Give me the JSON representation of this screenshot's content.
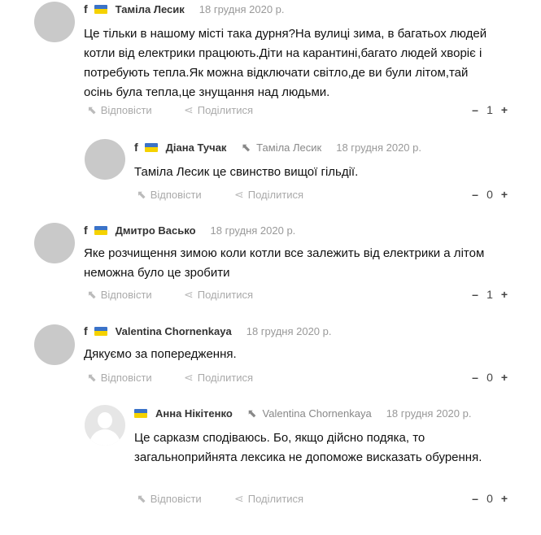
{
  "labels": {
    "reply": "Відповісти",
    "share": "Поділитися"
  },
  "icons": {
    "reply": "reply-arrow-icon",
    "share": "share-icon",
    "facebook": "facebook-icon",
    "flag": "ukraine-flag-icon"
  },
  "colors": {
    "flag_blue": "#3b73c8",
    "flag_yellow": "#f5d200"
  },
  "comments": [
    {
      "author": "Таміла Лесик",
      "date": "18 грудня 2020 р.",
      "text": "Це тільки в нашому місті така дурня?На вулиці зима, в багатьох людей котли від електрики працюють.Діти на карантині,багато людей хворіє і потребують тепла.Як можна відключати світло,де ви були літом,тай осінь була тепла,це знущання над людьми.",
      "votes": "1"
    },
    {
      "author": "Діана Тучак",
      "reply_to": "Таміла Лесик",
      "date": "18 грудня 2020 р.",
      "text": "Таміла Лесик це свинство вищої гільдії.",
      "votes": "0"
    },
    {
      "author": "Дмитро Васько",
      "date": "18 грудня 2020 р.",
      "text": "Яке розчищення зимою коли котли все залежить від електрики а літом неможна було це зробити",
      "votes": "1"
    },
    {
      "author": "Valentina Chornenkaya",
      "date": "18 грудня 2020 р.",
      "text": "Дякуємо за попередження.",
      "votes": "0"
    },
    {
      "author": "Анна Нікітенко",
      "reply_to": "Valentina Chornenkaya",
      "date": "18 грудня 2020 р.",
      "text": "Це сарказм сподіваюсь. Бо, якщо дійсно подяка, то загальноприйнята лексика не допоможе висказать обурення.",
      "votes": "0"
    }
  ]
}
